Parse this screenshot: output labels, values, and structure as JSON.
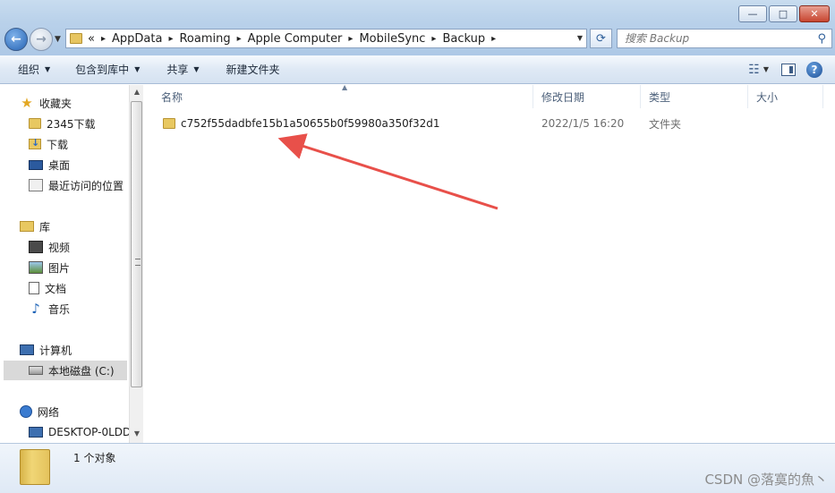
{
  "window": {
    "minimize": "—",
    "maximize": "□",
    "close": "✕"
  },
  "nav": {
    "back": "←",
    "forward": "→"
  },
  "address": {
    "overflow": "«",
    "segments": [
      "AppData",
      "Roaming",
      "Apple Computer",
      "MobileSync",
      "Backup"
    ],
    "separator": "▸"
  },
  "search": {
    "placeholder": "搜索 Backup"
  },
  "toolbar": {
    "organize": "组织",
    "include_in_library": "包含到库中",
    "share": "共享",
    "new_folder": "新建文件夹"
  },
  "sidebar": {
    "favorites": "收藏夹",
    "fav_2345": "2345下载",
    "fav_downloads": "下载",
    "fav_desktop": "桌面",
    "fav_recent": "最近访问的位置",
    "libraries": "库",
    "lib_video": "视频",
    "lib_pictures": "图片",
    "lib_docs": "文档",
    "lib_music": "音乐",
    "computer": "计算机",
    "local_disk": "本地磁盘 (C:)",
    "network": "网络",
    "net_desktop": "DESKTOP-0LDD"
  },
  "columns": {
    "name": "名称",
    "modified": "修改日期",
    "type": "类型",
    "size": "大小"
  },
  "files": [
    {
      "name": "c752f55dadbfe15b1a50655b0f59980a350f32d1",
      "modified": "2022/1/5 16:20",
      "type": "文件夹",
      "size": ""
    }
  ],
  "status": {
    "count": "1 个对象"
  },
  "watermark": "CSDN @落寞的魚丶",
  "colors": {
    "annotation_arrow": "#e8504a"
  }
}
